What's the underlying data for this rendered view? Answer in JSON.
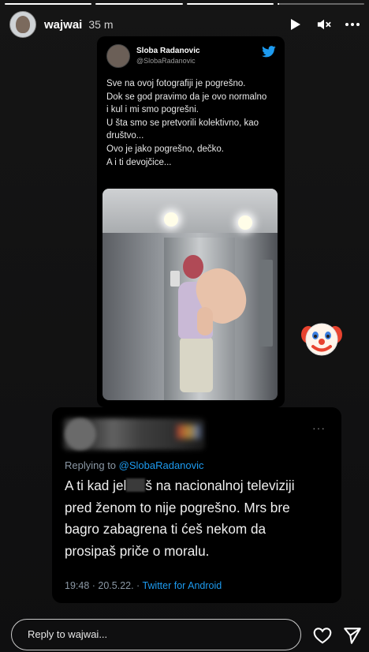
{
  "story": {
    "progress": [
      1.0,
      1.0,
      1.0,
      0.02
    ],
    "username": "wajwai",
    "time_ago": "35 m",
    "icons": [
      "play-icon",
      "mute-icon",
      "more-icon"
    ]
  },
  "tweet1": {
    "name": "Sloba Radanovic",
    "handle": "@SlobaRadanovic",
    "lines": [
      "Sve na ovoj fotografiji je pogrešno.",
      "Dok se god pravimo da je ovo normalno",
      "i kul i mi smo pogrešni.",
      "U šta smo se pretvorili kolektivno, kao",
      "društvo...",
      "Ovo je jako pogrešno, dečko.",
      "A i ti devojčice..."
    ]
  },
  "tweet2": {
    "more": "···",
    "replying_prefix": "Replying to ",
    "replying_to": "@SlobaRadanovic",
    "line1_a": "A ti kad jel",
    "line1_b": "š na nacionalnoj televiziji",
    "lines": [
      "pred ženom to nije pogrešno. Mrs bre",
      "bagro zabagrena ti ćeš nekom da",
      "prosipaš priče o moralu."
    ],
    "timestamp": "19:48 · 20.5.22. · ",
    "client": "Twitter for Android"
  },
  "reply": {
    "placeholder": "Reply to wajwai..."
  },
  "colors": {
    "twitter_blue": "#1d9bf0",
    "background": "#111214"
  }
}
